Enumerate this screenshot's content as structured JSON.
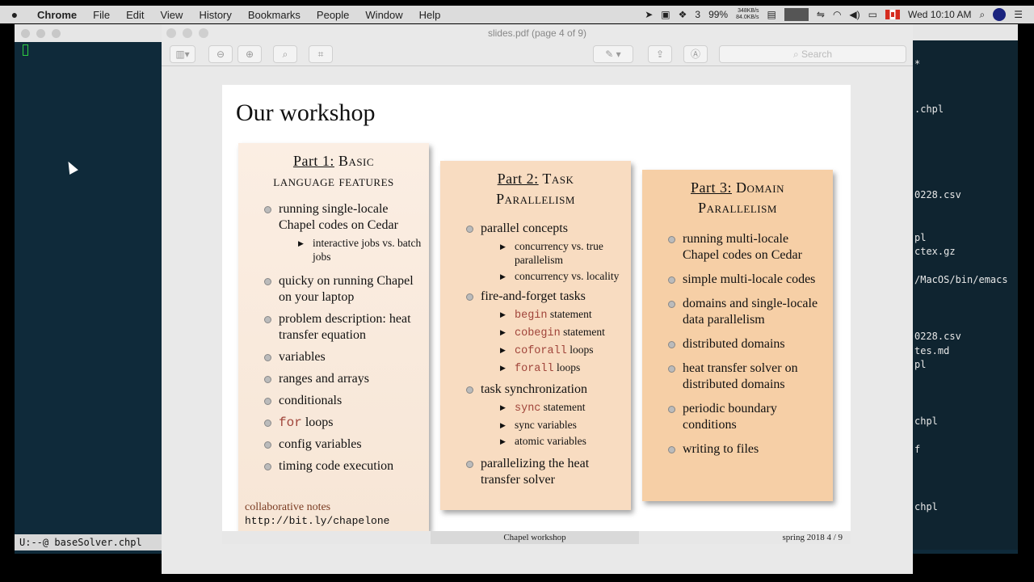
{
  "menubar": {
    "app": "Chrome",
    "items": [
      "File",
      "Edit",
      "View",
      "History",
      "Bookmarks",
      "People",
      "Window",
      "Help"
    ],
    "notifications": "3",
    "battery": "99%",
    "net_up": "348KB/s",
    "net_down": "84.0KB/s",
    "clock": "Wed 10:10 AM"
  },
  "terminal": {
    "modeline": "U:--@  baseSolver.chpl",
    "right_lines": [
      "*",
      ".chpl",
      "0228.csv",
      "pl",
      "ctex.gz",
      "/MacOS/bin/emacs",
      "0228.csv",
      "tes.md",
      "pl",
      "chpl",
      "f",
      "chpl"
    ]
  },
  "preview": {
    "window_title": "slides.pdf (page 4 of 9)",
    "search_placeholder": "Search"
  },
  "slide": {
    "title": "Our workshop",
    "part1": {
      "title_a": "Part 1:",
      "title_b": " Basic",
      "title_c": "language features",
      "items": {
        "i1": "running single-locale Chapel codes on Cedar",
        "i1s1": "interactive jobs vs. batch jobs",
        "i2": "quicky on running Chapel on your laptop",
        "i3": "problem description: heat transfer equation",
        "i4": "variables",
        "i5": "ranges and arrays",
        "i6": "conditionals",
        "i7_code": "for",
        "i7_text": " loops",
        "i8": "config variables",
        "i9": "timing code execution"
      },
      "notes_label": "collaborative notes",
      "notes_url": "http://bit.ly/chapelone"
    },
    "part2": {
      "title_a": "Part 2:",
      "title_b": " Task",
      "title_c": "Parallelism",
      "items": {
        "i1": "parallel concepts",
        "i1s1": "concurrency vs. true parallelism",
        "i1s2": "concurrency vs. locality",
        "i2": "fire-and-forget tasks",
        "i2s1_code": "begin",
        "i2s1_text": " statement",
        "i2s2_code": "cobegin",
        "i2s2_text": " statement",
        "i2s3_code": "coforall",
        "i2s3_text": " loops",
        "i2s4_code": "forall",
        "i2s4_text": " loops",
        "i3": "task synchronization",
        "i3s1_code": "sync",
        "i3s1_text": " statement",
        "i3s2": "sync variables",
        "i3s3": "atomic variables",
        "i4": "parallelizing the heat transfer solver"
      }
    },
    "part3": {
      "title_a": "Part 3:",
      "title_b": " Domain",
      "title_c": "Parallelism",
      "items": {
        "i1": "running multi-locale Chapel codes on Cedar",
        "i2": "simple multi-locale codes",
        "i3": "domains and single-locale data parallelism",
        "i4": "distributed domains",
        "i5": "heat transfer solver on distributed domains",
        "i6": "periodic boundary conditions",
        "i7": "writing to files"
      }
    },
    "footer": {
      "center": "Chapel workshop",
      "right": "spring 2018      4 / 9"
    }
  }
}
